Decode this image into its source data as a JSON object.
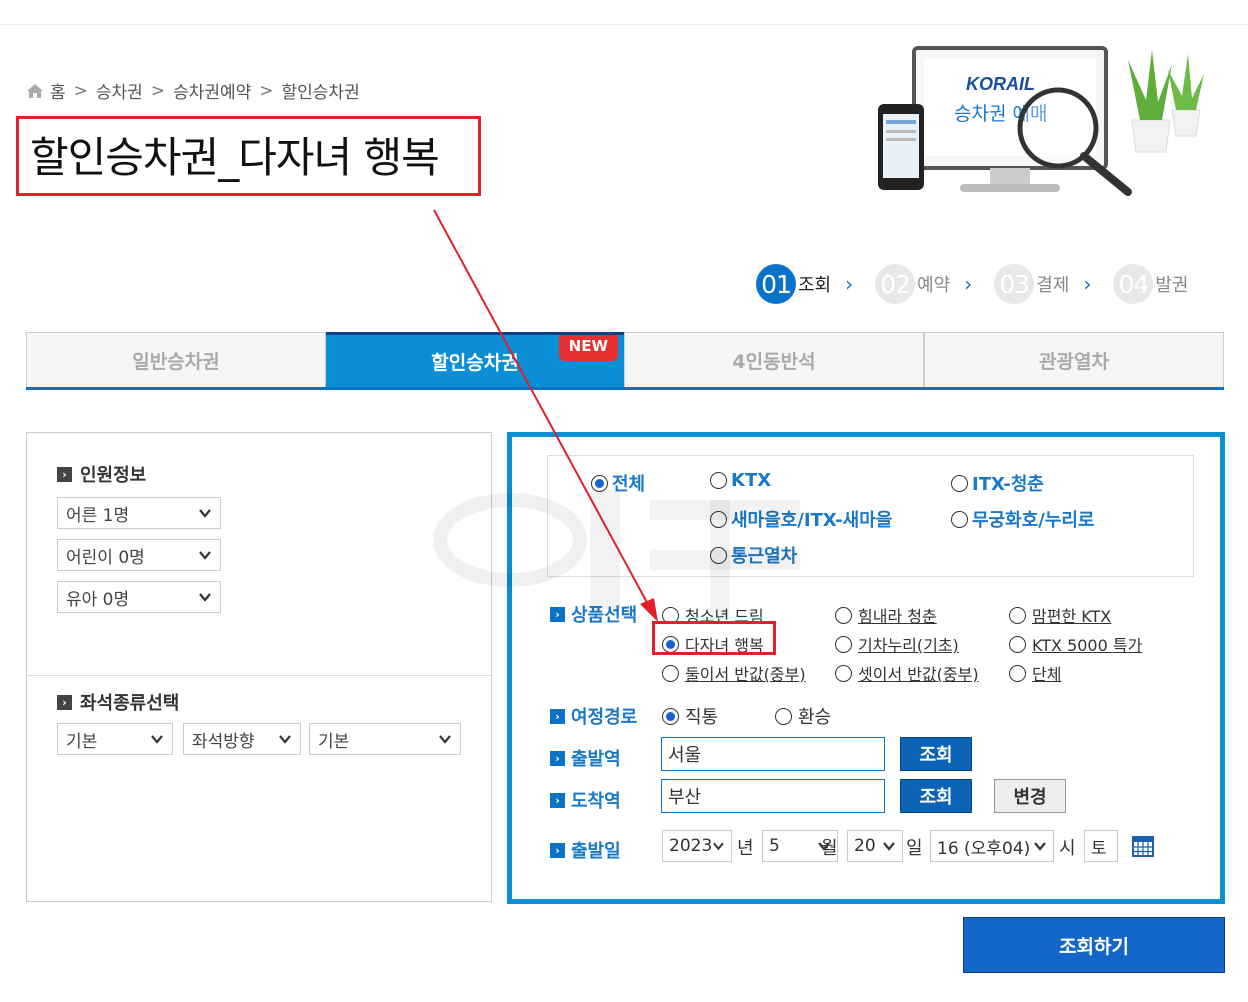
{
  "breadcrumb": [
    "홈",
    "승차권",
    "승차권예약",
    "할인승차권"
  ],
  "page_title": "할인승차권_다자녀 행복",
  "hero": {
    "brand": "KORAIL",
    "caption": "승차권 예매"
  },
  "steps": [
    {
      "num": "01",
      "label": "조회",
      "active": true
    },
    {
      "num": "02",
      "label": "예약",
      "active": false
    },
    {
      "num": "03",
      "label": "결제",
      "active": false
    },
    {
      "num": "04",
      "label": "발권",
      "active": false
    }
  ],
  "tabs": [
    {
      "label": "일반승차권"
    },
    {
      "label": "할인승차권",
      "badge": "NEW"
    },
    {
      "label": "4인동반석"
    },
    {
      "label": "관광열차"
    }
  ],
  "left": {
    "passenger_heading": "인원정보",
    "adult": "어른 1명",
    "child": "어린이 0명",
    "infant": "유아 0명",
    "seat_heading": "좌석종류선택",
    "seat_type": "기본",
    "seat_direction": "좌석방향",
    "seat_extra": "기본"
  },
  "train_types": {
    "all": "전체",
    "ktx": "KTX",
    "itx_cheongchun": "ITX-청춘",
    "saemaeul": "새마을호/ITX-새마을",
    "mugunghwa": "무궁화호/누리로",
    "commuter": "통근열차",
    "selected": "전체"
  },
  "product": {
    "heading": "상품선택",
    "items": [
      "청소년 드림",
      "힘내라 청춘",
      "맘편한 KTX",
      "다자녀 행복",
      "기차누리(기초)",
      "KTX 5000 특가",
      "둘이서 반값(중부)",
      "셋이서 반값(중부)",
      "단체"
    ],
    "selected": "다자녀 행복"
  },
  "route": {
    "heading": "여정경로",
    "direct": "직통",
    "transfer": "환승",
    "selected": "직통"
  },
  "departure": {
    "heading": "출발역",
    "value": "서울",
    "button": "조회"
  },
  "arrival": {
    "heading": "도착역",
    "value": "부산",
    "button": "조회",
    "swap": "변경"
  },
  "date": {
    "heading": "출발일",
    "year": "2023",
    "year_unit": "년",
    "month": "5",
    "month_unit": "월",
    "day": "20",
    "day_unit": "일",
    "hour": "16 (오후04)",
    "hour_unit": "시",
    "weekday": "토"
  },
  "search_button": "조회하기",
  "colors": {
    "accent": "#0a8ed6",
    "highlight": "#e0202a",
    "button": "#1466c8"
  }
}
